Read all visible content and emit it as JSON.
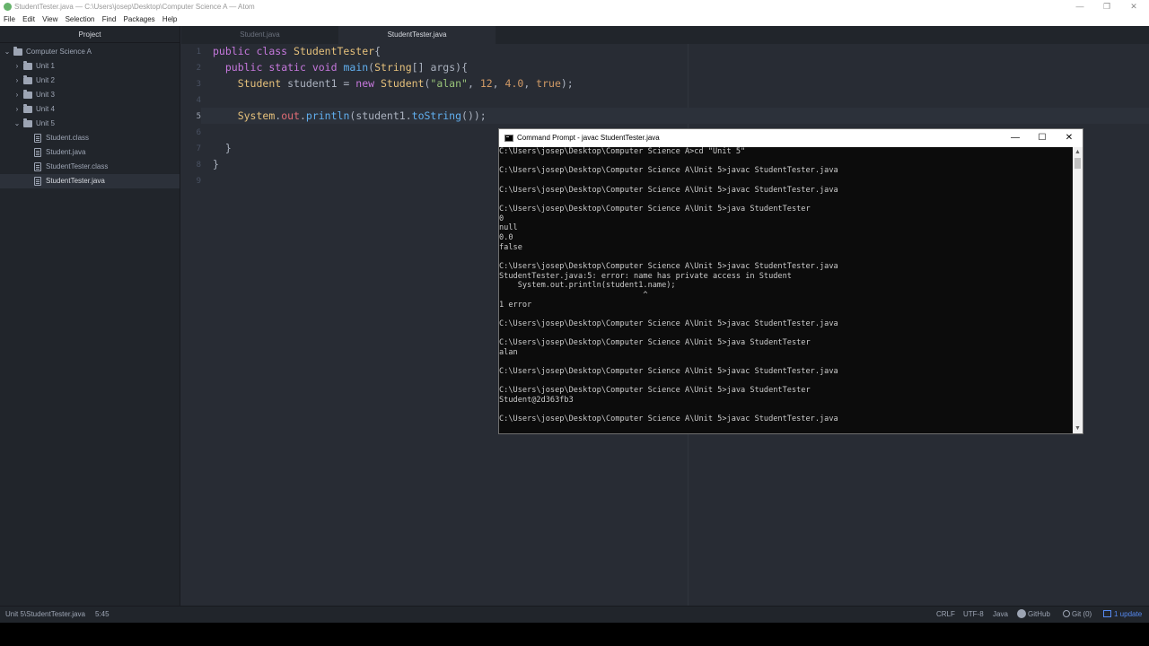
{
  "window": {
    "title": "StudentTester.java — C:\\Users\\josep\\Desktop\\Computer Science A — Atom",
    "controls": {
      "minimize": "—",
      "maximize": "❐",
      "close": "✕"
    }
  },
  "menu": [
    "File",
    "Edit",
    "View",
    "Selection",
    "Find",
    "Packages",
    "Help"
  ],
  "tree": {
    "header": "Project",
    "root": "Computer Science A",
    "items": [
      {
        "label": "Unit 1",
        "type": "folder",
        "expanded": false
      },
      {
        "label": "Unit 2",
        "type": "folder",
        "expanded": false
      },
      {
        "label": "Unit 3",
        "type": "folder",
        "expanded": false
      },
      {
        "label": "Unit 4",
        "type": "folder",
        "expanded": false
      },
      {
        "label": "Unit 5",
        "type": "folder",
        "expanded": true
      },
      {
        "label": "Student.class",
        "type": "file"
      },
      {
        "label": "Student.java",
        "type": "file"
      },
      {
        "label": "StudentTester.class",
        "type": "file"
      },
      {
        "label": "StudentTester.java",
        "type": "file",
        "selected": true
      }
    ]
  },
  "tabs": [
    {
      "label": "Student.java",
      "active": false
    },
    {
      "label": "StudentTester.java",
      "active": true
    }
  ],
  "editor": {
    "line_numbers": [
      "1",
      "2",
      "3",
      "4",
      "5",
      "6",
      "7",
      "8",
      "9"
    ],
    "current_line": 5,
    "lines": [
      "public class StudentTester{",
      "  public static void main(String[] args){",
      "    Student student1 = new Student(\"alan\", 12, 4.0, true);",
      "",
      "    System.out.println(student1.toString());",
      "",
      "  }",
      "}",
      ""
    ]
  },
  "status": {
    "path": "Unit 5\\StudentTester.java",
    "cursor": "5:45",
    "line_ending": "CRLF",
    "encoding": "UTF-8",
    "grammar": "Java",
    "github": "GitHub",
    "git": "Git (0)",
    "update": "1 update"
  },
  "cmd": {
    "title": "Command Prompt - javac  StudentTester.java",
    "controls": {
      "minimize": "—",
      "maximize": "☐",
      "close": "✕"
    },
    "output": "C:\\Users\\josep\\Desktop\\Computer Science A>cd \"Unit 5\"\n\nC:\\Users\\josep\\Desktop\\Computer Science A\\Unit 5>javac StudentTester.java\n\nC:\\Users\\josep\\Desktop\\Computer Science A\\Unit 5>javac StudentTester.java\n\nC:\\Users\\josep\\Desktop\\Computer Science A\\Unit 5>java StudentTester\n0\nnull\n0.0\nfalse\n\nC:\\Users\\josep\\Desktop\\Computer Science A\\Unit 5>javac StudentTester.java\nStudentTester.java:5: error: name has private access in Student\n    System.out.println(student1.name);\n                               ^\n1 error\n\nC:\\Users\\josep\\Desktop\\Computer Science A\\Unit 5>javac StudentTester.java\n\nC:\\Users\\josep\\Desktop\\Computer Science A\\Unit 5>java StudentTester\nalan\n\nC:\\Users\\josep\\Desktop\\Computer Science A\\Unit 5>javac StudentTester.java\n\nC:\\Users\\josep\\Desktop\\Computer Science A\\Unit 5>java StudentTester\nStudent@2d363fb3\n\nC:\\Users\\josep\\Desktop\\Computer Science A\\Unit 5>javac StudentTester.java"
  },
  "colors": {
    "editor_bg": "#282c34",
    "panel_bg": "#21252b",
    "keyword": "#c678dd",
    "class": "#e5c07b",
    "function": "#61afef",
    "string": "#98c379",
    "number": "#d19a66",
    "cmd_bg": "#0c0c0c",
    "cmd_text": "#cccccc"
  }
}
